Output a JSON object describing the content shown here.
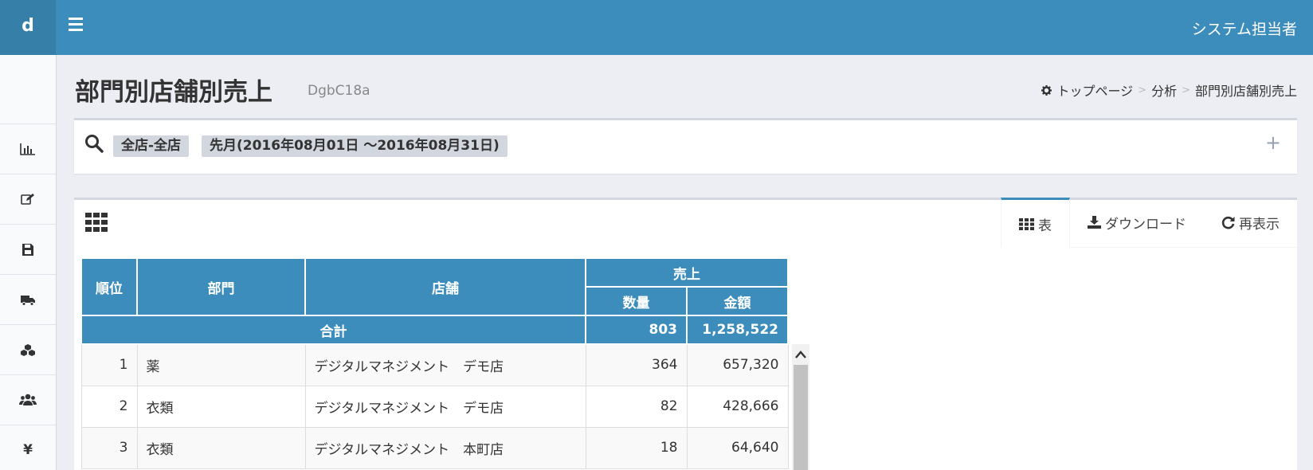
{
  "app": {
    "logo": "d",
    "user": "システム担当者"
  },
  "sidebar": {
    "items": [
      "chart-icon",
      "edit-icon",
      "save-icon",
      "truck-icon",
      "cubes-icon",
      "users-icon",
      "yen-icon"
    ],
    "yen_symbol": "¥"
  },
  "header": {
    "title": "部門別店舗別売上",
    "code": "DgbC18a"
  },
  "breadcrumb": {
    "home": "トップページ",
    "section": "分析",
    "current": "部門別店舗別売上",
    "separator": ">"
  },
  "filter": {
    "tags": [
      "全店-全店",
      "先月(2016年08月01日 〜2016年08月31日)"
    ],
    "expand": "+"
  },
  "tabs": {
    "table": "表",
    "download": "ダウンロード",
    "refresh": "再表示"
  },
  "table": {
    "headers": {
      "rank": "順位",
      "dept": "部門",
      "store": "店舗",
      "sales": "売上",
      "qty": "数量",
      "amount": "金額"
    },
    "total": {
      "label": "合計",
      "qty": "803",
      "amount": "1,258,522"
    },
    "rows": [
      {
        "rank": "1",
        "dept": "薬",
        "store": "デジタルマネジメント　デモ店",
        "qty": "364",
        "amount": "657,320"
      },
      {
        "rank": "2",
        "dept": "衣類",
        "store": "デジタルマネジメント　デモ店",
        "qty": "82",
        "amount": "428,666"
      },
      {
        "rank": "3",
        "dept": "衣類",
        "store": "デジタルマネジメント　本町店",
        "qty": "18",
        "amount": "64,640"
      }
    ]
  },
  "colors": {
    "primary": "#3c8dbc",
    "logo_bg": "#367fa9",
    "background": "#eceef3"
  }
}
